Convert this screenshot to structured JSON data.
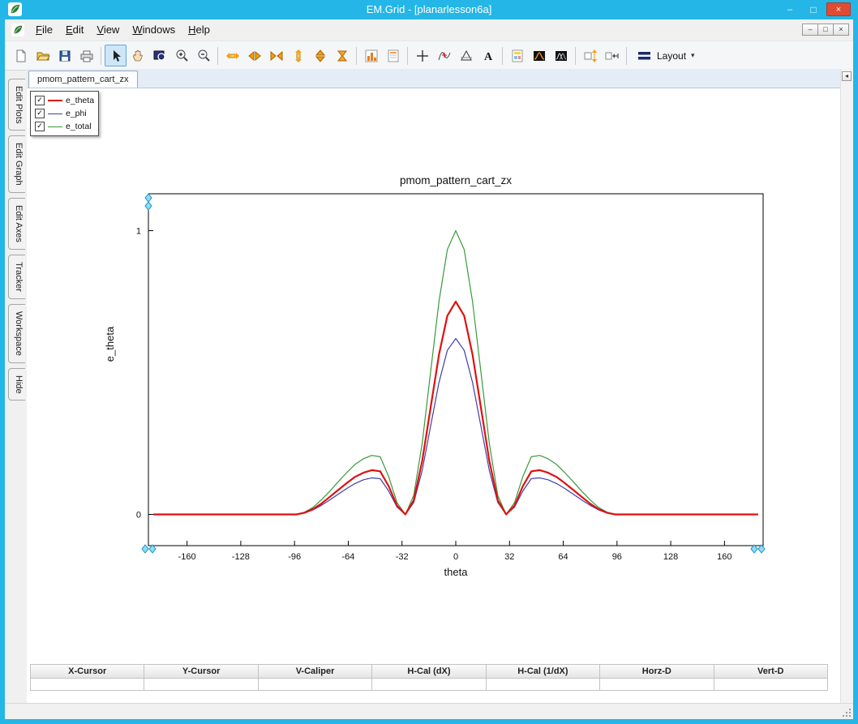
{
  "window": {
    "title": "EM.Grid - [planarlesson6a]",
    "controls": {
      "minimize": "–",
      "maximize": "□",
      "close": "×"
    },
    "accent_color": "#23b6e6"
  },
  "menubar": {
    "items": [
      {
        "label": "File"
      },
      {
        "label": "Edit"
      },
      {
        "label": "View"
      },
      {
        "label": "Windows"
      },
      {
        "label": "Help"
      }
    ],
    "mdi_controls": [
      {
        "name": "mdi-minimize",
        "glyph": "–"
      },
      {
        "name": "mdi-restore",
        "glyph": "□"
      },
      {
        "name": "mdi-close",
        "glyph": "×"
      }
    ]
  },
  "toolbar": {
    "layout_label": "Layout",
    "buttons": [
      {
        "name": "new"
      },
      {
        "name": "open"
      },
      {
        "name": "save"
      },
      {
        "name": "print"
      },
      {
        "separator": true
      },
      {
        "name": "select",
        "active": true
      },
      {
        "name": "pan"
      },
      {
        "name": "zoom-window"
      },
      {
        "name": "zoom-in"
      },
      {
        "name": "zoom-out"
      },
      {
        "separator": true
      },
      {
        "name": "expand-x"
      },
      {
        "name": "scroll-x"
      },
      {
        "name": "compress-x"
      },
      {
        "name": "expand-y"
      },
      {
        "name": "scroll-y"
      },
      {
        "name": "autoscale"
      },
      {
        "separator": true
      },
      {
        "name": "histogram"
      },
      {
        "name": "data-sheet"
      },
      {
        "separator": true
      },
      {
        "name": "crosshair"
      },
      {
        "name": "tracker"
      },
      {
        "name": "caliper"
      },
      {
        "name": "text-tool"
      },
      {
        "separator": true
      },
      {
        "name": "page-color"
      },
      {
        "name": "plot-dark-1"
      },
      {
        "name": "plot-dark-2"
      },
      {
        "separator": true
      },
      {
        "name": "fit-vertical"
      },
      {
        "name": "fit-horizontal"
      },
      {
        "separator": true
      },
      {
        "name": "layout",
        "label": "Layout",
        "dropdown": true
      }
    ]
  },
  "sidebar": {
    "tabs": [
      "Edit Plots",
      "Edit Graph",
      "Edit Axes",
      "Tracker",
      "Workspace",
      "Hide"
    ]
  },
  "document_tabs": [
    {
      "label": "pmom_pattern_cart_zx",
      "active": true
    }
  ],
  "tabstrip": {
    "scroll_button_glyph": "◂"
  },
  "legend": {
    "check_glyph": "✓",
    "items": [
      {
        "label": "e_theta",
        "color": "#e01010",
        "checked": true
      },
      {
        "label": "e_phi",
        "color": "#4040a8",
        "checked": true
      },
      {
        "label": "e_total",
        "color": "#3a9b3a",
        "checked": true
      }
    ]
  },
  "chart_data": {
    "type": "line",
    "title": "pmom_pattern_cart_zx",
    "xlabel": "theta",
    "ylabel": "e_theta",
    "xlim": [
      -183,
      183
    ],
    "ylim": [
      -0.11,
      1.13
    ],
    "xticks": [
      -160,
      -128,
      -96,
      -64,
      -32,
      0,
      32,
      64,
      96,
      128,
      160
    ],
    "yticks": [
      0,
      1
    ],
    "grid": false,
    "legend_position": "top-left",
    "x": [
      -180,
      -175,
      -170,
      -165,
      -160,
      -155,
      -150,
      -145,
      -140,
      -135,
      -130,
      -125,
      -120,
      -115,
      -110,
      -105,
      -100,
      -95,
      -90,
      -85,
      -80,
      -75,
      -70,
      -65,
      -60,
      -55,
      -50,
      -45,
      -40,
      -35,
      -30,
      -25,
      -20,
      -15,
      -10,
      -5,
      0,
      5,
      10,
      15,
      20,
      25,
      30,
      35,
      40,
      45,
      50,
      55,
      60,
      65,
      70,
      75,
      80,
      85,
      90,
      95,
      100,
      105,
      110,
      115,
      120,
      125,
      130,
      135,
      140,
      145,
      150,
      155,
      160,
      165,
      170,
      175,
      180
    ],
    "series": [
      {
        "name": "e_theta",
        "color": "#e01010",
        "width": 2.2,
        "values": [
          0,
          0,
          0,
          0,
          0,
          0,
          0,
          0,
          0,
          0,
          0,
          0,
          0,
          0,
          0,
          0,
          0,
          0,
          0.006,
          0.019,
          0.038,
          0.062,
          0.086,
          0.11,
          0.132,
          0.147,
          0.156,
          0.152,
          0.1,
          0.031,
          0,
          0.05,
          0.188,
          0.375,
          0.563,
          0.7,
          0.75,
          0.7,
          0.563,
          0.375,
          0.188,
          0.05,
          0,
          0.031,
          0.1,
          0.152,
          0.156,
          0.147,
          0.132,
          0.11,
          0.086,
          0.062,
          0.038,
          0.019,
          0.006,
          0,
          0,
          0,
          0,
          0,
          0,
          0,
          0,
          0,
          0,
          0,
          0,
          0,
          0,
          0,
          0,
          0,
          0
        ]
      },
      {
        "name": "e_phi",
        "color": "#4040a8",
        "width": 1.2,
        "values": [
          0,
          0,
          0,
          0,
          0,
          0,
          0,
          0,
          0,
          0,
          0,
          0,
          0,
          0,
          0,
          0,
          0,
          0,
          0.005,
          0.016,
          0.032,
          0.051,
          0.071,
          0.091,
          0.109,
          0.122,
          0.129,
          0.126,
          0.083,
          0.026,
          0,
          0.042,
          0.155,
          0.31,
          0.465,
          0.578,
          0.62,
          0.578,
          0.465,
          0.31,
          0.155,
          0.042,
          0,
          0.026,
          0.083,
          0.126,
          0.129,
          0.122,
          0.109,
          0.091,
          0.071,
          0.051,
          0.032,
          0.016,
          0.005,
          0,
          0,
          0,
          0,
          0,
          0,
          0,
          0,
          0,
          0,
          0,
          0,
          0,
          0,
          0,
          0,
          0,
          0
        ]
      },
      {
        "name": "e_total",
        "color": "#3a9b3a",
        "width": 1.2,
        "values": [
          0,
          0,
          0,
          0,
          0,
          0,
          0,
          0,
          0,
          0,
          0,
          0,
          0,
          0,
          0,
          0,
          0,
          0,
          0.008,
          0.025,
          0.051,
          0.082,
          0.115,
          0.147,
          0.176,
          0.196,
          0.208,
          0.203,
          0.134,
          0.042,
          0,
          0.067,
          0.25,
          0.5,
          0.75,
          0.933,
          1.0,
          0.933,
          0.75,
          0.5,
          0.25,
          0.067,
          0,
          0.042,
          0.134,
          0.203,
          0.208,
          0.196,
          0.176,
          0.147,
          0.115,
          0.082,
          0.051,
          0.025,
          0.008,
          0,
          0,
          0,
          0,
          0,
          0,
          0,
          0,
          0,
          0,
          0,
          0,
          0,
          0,
          0,
          0,
          0,
          0
        ]
      }
    ]
  },
  "readout_table": {
    "headers": [
      "X-Cursor",
      "Y-Cursor",
      "V-Caliper",
      "H-Cal (dX)",
      "H-Cal (1/dX)",
      "Horz-D",
      "Vert-D"
    ],
    "values": [
      "",
      "",
      "",
      "",
      "",
      "",
      ""
    ]
  }
}
